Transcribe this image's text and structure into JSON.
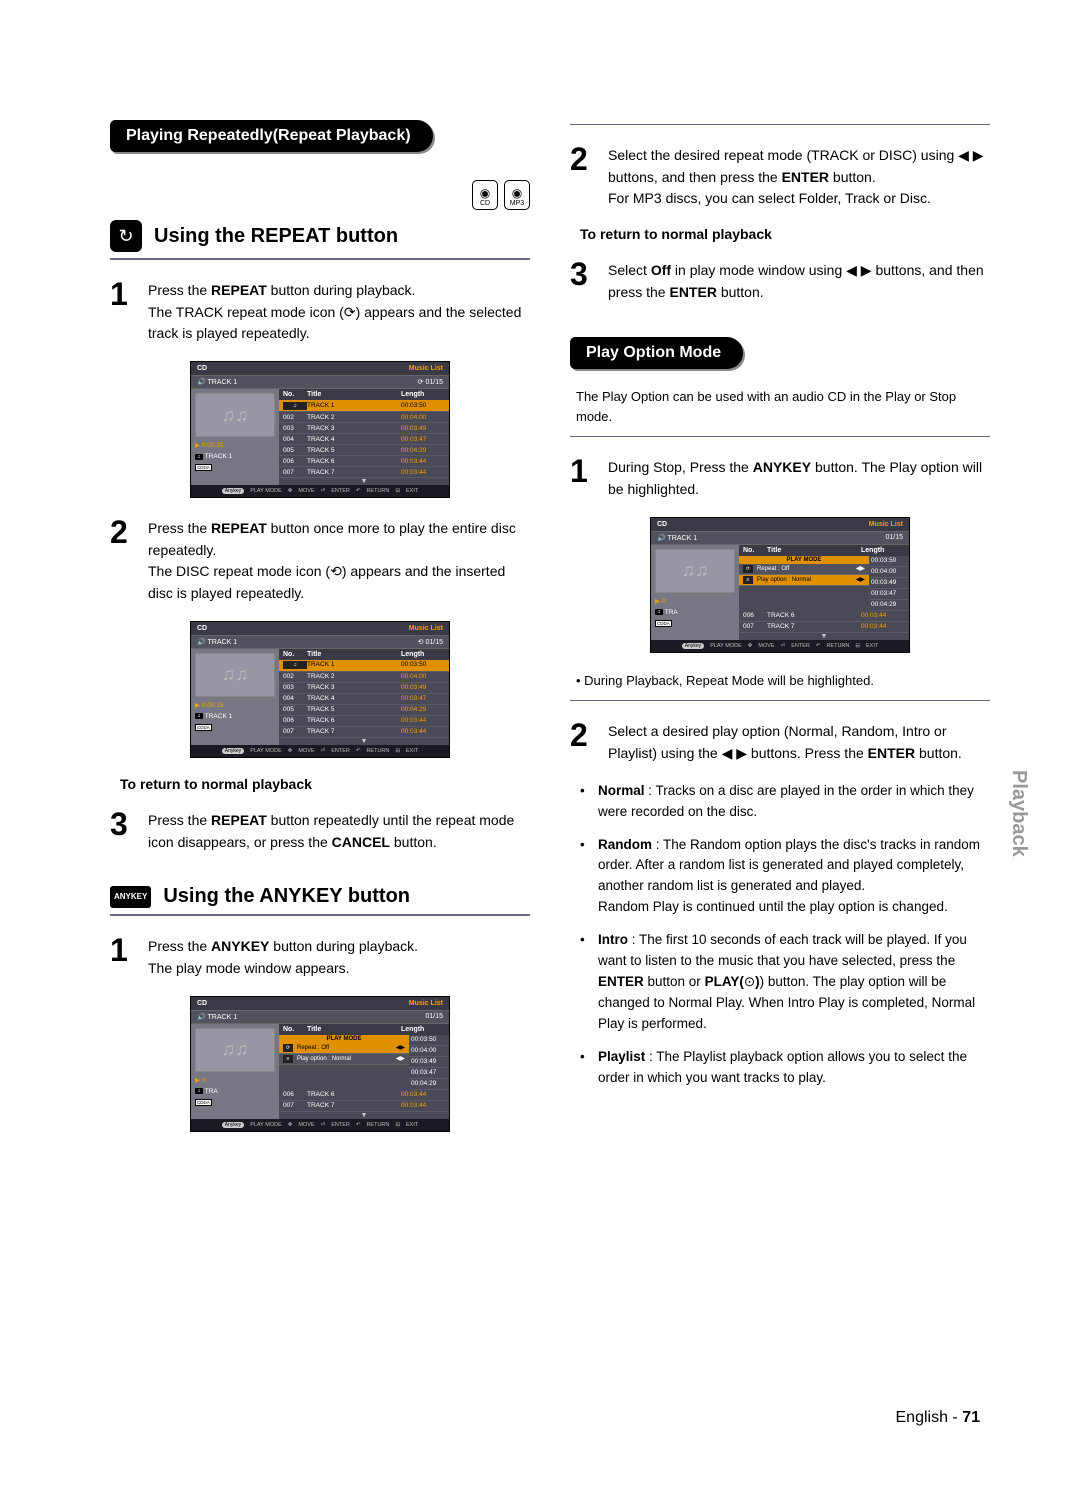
{
  "section1_title": "Playing Repeatedly(Repeat Playback)",
  "disc_labels": {
    "cd": "CD",
    "mp3": "MP3"
  },
  "repeat_heading": "Using the REPEAT button",
  "repeat_step1_a": "Press the ",
  "repeat_step1_b": "REPEAT",
  "repeat_step1_c": " button during playback.",
  "repeat_step1_d": "The TRACK repeat mode icon (",
  "repeat_step1_e": ") appears and the selected track is played repeatedly.",
  "repeat_step2_a": "Press the ",
  "repeat_step2_b": "REPEAT",
  "repeat_step2_c": " button once more to play the entire disc repeatedly.",
  "repeat_step2_d": "The DISC repeat mode icon (",
  "repeat_step2_e": ") appears and the inserted disc is played repeatedly.",
  "return_normal": "To return to normal playback",
  "repeat_step3_a": "Press the ",
  "repeat_step3_b": "REPEAT",
  "repeat_step3_c": " button repeatedly until the repeat mode icon disappears, or press the ",
  "repeat_step3_d": "CANCEL",
  "repeat_step3_e": " button.",
  "anykey_badge": "ANYKEY",
  "anykey_heading": "Using the ANYKEY button",
  "anykey_step1_a": "Press the ",
  "anykey_step1_b": "ANYKEY",
  "anykey_step1_c": " button during playback.",
  "anykey_step1_d": "The play mode window appears.",
  "r2_step2_a": "Select the desired repeat mode (TRACK or DISC) using ◀ ▶ buttons, and then press the ",
  "r2_step2_b": "ENTER",
  "r2_step2_c": " button.",
  "r2_step2_d": "For MP3 discs, you can select Folder, Track or Disc.",
  "r2_step3_a": "Select ",
  "r2_step3_b": "Off",
  "r2_step3_c": " in play mode window using ◀ ▶ buttons, and then press the ",
  "r2_step3_d": "ENTER",
  "r2_step3_e": " button.",
  "section2_title": "Play Option Mode",
  "s2_intro": "The Play Option can be used with an audio CD in the Play or Stop mode.",
  "s2_step1_a": "During Stop, Press the ",
  "s2_step1_b": "ANYKEY",
  "s2_step1_c": " button. The Play option will be highlighted.",
  "s2_note1": "• During Playback, Repeat Mode will be highlighted.",
  "s2_step2_a": "Select a desired play option (Normal, Random, Intro or Playlist) using the ◀ ▶ buttons. Press the ",
  "s2_step2_b": "ENTER",
  "s2_step2_c": " button.",
  "opt_normal_label": "Normal",
  "opt_normal_text": " : Tracks on a disc are played in the order in which they were recorded on the disc.",
  "opt_random_label": "Random",
  "opt_random_text": " : The Random option plays the disc's tracks in random order. After a random list is generated and played completely, another random list is generated and played.",
  "opt_random_text2": "Random Play is continued until the play option is changed.",
  "opt_intro_label": "Intro",
  "opt_intro_text_a": " : The first 10 seconds of each track will be played. If you want to listen to the music that you have selected, press the ",
  "opt_intro_enter": "ENTER",
  "opt_intro_text_b": " button or ",
  "opt_intro_play": "PLAY(",
  "opt_intro_text_c": ") button. The play option will be changed to Normal Play. When Intro Play is completed, Normal Play is  performed.",
  "opt_playlist_label": "Playlist",
  "opt_playlist_text": " : The Playlist playback option allows you to select the order in which you want tracks to play.",
  "footer_lang": "English - ",
  "footer_page": "71",
  "side_tab": "Playback",
  "osd": {
    "title_left": "CD",
    "title_right": "Music List",
    "sub_left": "🔊 TRACK 1",
    "page": "01/15",
    "thead": {
      "no": "No.",
      "title": "Title",
      "length": "Length"
    },
    "rows": [
      {
        "no": "",
        "title": "TRACK 1",
        "length": "00:03:50",
        "sel": true
      },
      {
        "no": "002",
        "title": "TRACK 2",
        "length": "00:04:00"
      },
      {
        "no": "003",
        "title": "TRACK 3",
        "length": "00:03:49"
      },
      {
        "no": "004",
        "title": "TRACK 4",
        "length": "00:03:47"
      },
      {
        "no": "005",
        "title": "TRACK 5",
        "length": "00:04:29"
      },
      {
        "no": "006",
        "title": "TRACK 6",
        "length": "00:03:44"
      },
      {
        "no": "007",
        "title": "TRACK 7",
        "length": "00:03:44"
      }
    ],
    "left_rows": {
      "time": "▶ 0:00:15",
      "track": "TRACK 1",
      "badge": "♫",
      "cdda": "CDDA"
    },
    "help": {
      "anykey": "Anykey",
      "playmode": "PLAY MODE",
      "move": "MOVE",
      "enter": "ENTER",
      "return": "RETURN",
      "exit": "EXIT"
    },
    "playmode": {
      "title": "PLAY MODE",
      "repeat": "Repeat : Off",
      "option": "Play option : Normal"
    }
  }
}
